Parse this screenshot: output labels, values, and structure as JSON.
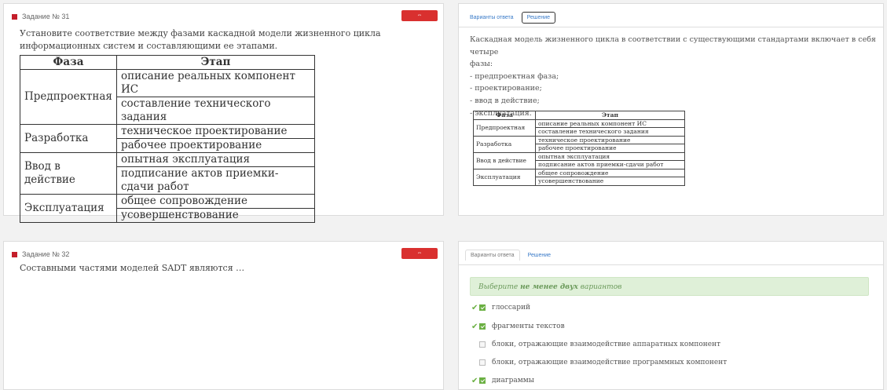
{
  "task31": {
    "number": "Задание № 31",
    "expand_label": "развернуть",
    "question": "Установите соответствие между фазами каскадной модели жизненного цикла информационных систем и составляющими ее этапами.",
    "table": {
      "headers": [
        "Фаза",
        "Этап"
      ],
      "rows": [
        {
          "phase": "Предпроектная",
          "stages": [
            "описание реальных компонент ИС",
            "составление технического задания"
          ]
        },
        {
          "phase": "Разработка",
          "stages": [
            "техническое проектирование",
            "рабочее проектирование"
          ]
        },
        {
          "phase": "Ввод в действие",
          "stages": [
            "опытная эксплуатация",
            "подписание актов приемки-сдачи работ"
          ]
        },
        {
          "phase": "Эксплуатация",
          "stages": [
            "общее сопровождение",
            "усовершенствование"
          ]
        }
      ]
    }
  },
  "solution31": {
    "tabs": [
      "Варианты ответа",
      "Решение"
    ],
    "lines": [
      "Каскадная модель жизненного цикла в соответствии с существующими стандартами включает в себя четыре",
      "фазы:",
      "- предпроектная фаза;",
      "- проектирование;",
      "- ввод в действие;",
      "- эксплуатация."
    ]
  },
  "task32": {
    "number": "Задание № 32",
    "expand_label": "развернуть",
    "question": "Составными частями моделей SADT являются …"
  },
  "answers32": {
    "tabs": [
      "Варианты ответа",
      "Решение"
    ],
    "hint_pre": "Выберите",
    "hint_bold": "не менее двух",
    "hint_post": "вариантов",
    "options": [
      {
        "label": "глоссарий",
        "checked": true
      },
      {
        "label": "фрагменты текстов",
        "checked": true
      },
      {
        "label": "блоки, отражающие взаимодействие аппаратных компонент",
        "checked": false
      },
      {
        "label": "блоки, отражающие взаимодействие программных компонент",
        "checked": false
      },
      {
        "label": "диаграммы",
        "checked": true
      }
    ]
  },
  "colors": {
    "accent_red": "#d9302f",
    "link_blue": "#3a7bc8",
    "check_green": "#6bb043",
    "hint_bg": "#dff0d8"
  }
}
